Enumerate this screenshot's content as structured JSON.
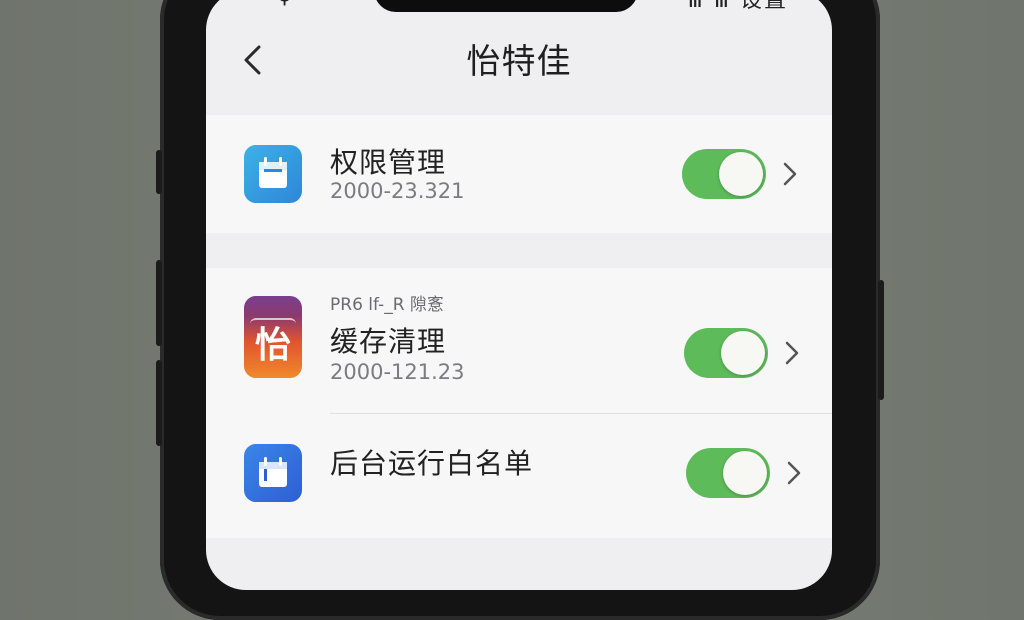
{
  "status_bar": {
    "left": "ψ",
    "right": "Ⅲ Ⅲ 设置"
  },
  "nav": {
    "title": "怡特佳"
  },
  "items": [
    {
      "title": "权限管理",
      "subtitle": "2000-23.321",
      "tag": "",
      "icon": "calendar-icon",
      "enabled": true
    },
    {
      "title": "缓存清理",
      "subtitle": "2000-121.23",
      "tag": "PR6 lf-_R 隙愙",
      "icon": "app-logo-icon",
      "icon_glyph": "怡",
      "enabled": true
    },
    {
      "title": "后台运行白名单",
      "subtitle": "",
      "tag": "",
      "icon": "calendar-icon",
      "enabled": true
    }
  ],
  "colors": {
    "toggle_on": "#5dbb5a",
    "screen_bg": "#efeff1",
    "card_bg": "#f7f7f8"
  }
}
